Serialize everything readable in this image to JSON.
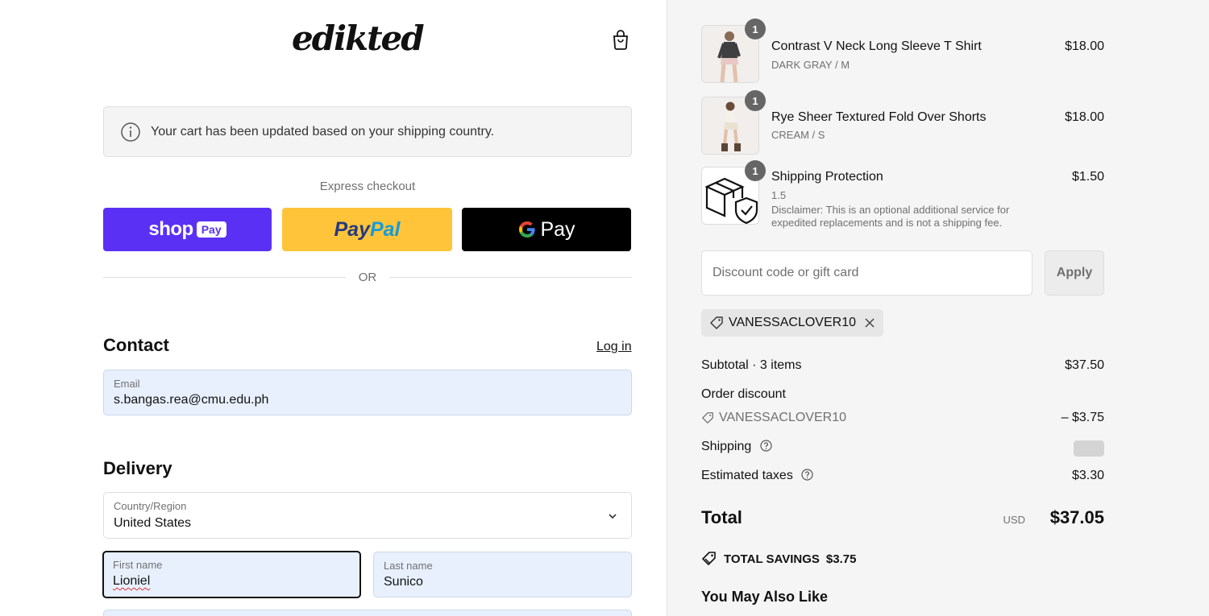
{
  "brand": {
    "logo_text": "edikted"
  },
  "header": {
    "cart_icon": "shopping-bag-icon"
  },
  "notice": {
    "text": "Your cart has been updated based on your shipping country.",
    "icon": "info-icon"
  },
  "express": {
    "label": "Express checkout",
    "shop_pay": {
      "word": "shop",
      "badge": "Pay"
    },
    "paypal": {
      "part1": "Pay",
      "part2": "Pal"
    },
    "gpay": {
      "word": "Pay"
    },
    "or_text": "OR"
  },
  "contact": {
    "title": "Contact",
    "login_label": "Log in",
    "email": {
      "label": "Email",
      "value": "s.bangas.rea@cmu.edu.ph"
    }
  },
  "delivery": {
    "title": "Delivery",
    "country": {
      "label": "Country/Region",
      "value": "United States"
    },
    "first_name": {
      "label": "First name",
      "value": "Lioniel"
    },
    "last_name": {
      "label": "Last name",
      "value": "Sunico"
    }
  },
  "order": {
    "items": [
      {
        "name": "Contrast V Neck Long Sleeve T Shirt",
        "variant": "DARK GRAY / M",
        "price": "$18.00",
        "qty": "1"
      },
      {
        "name": "Rye Sheer Textured Fold Over Shorts",
        "variant": "CREAM / S",
        "price": "$18.00",
        "qty": "1"
      },
      {
        "name": "Shipping Protection",
        "variant": "1.5",
        "price": "$1.50",
        "qty": "1",
        "note": "Disclaimer: This is an optional additional service for expedited replacements and is not a shipping fee."
      }
    ],
    "discount": {
      "placeholder": "Discount code or gift card",
      "apply_label": "Apply"
    },
    "applied_code": "VANESSACLOVER10"
  },
  "summary": {
    "subtotal_label": "Subtotal · 3 items",
    "subtotal_value": "$37.50",
    "discount_label": "Order discount",
    "discount_code": "VANESSACLOVER10",
    "discount_value": "– $3.75",
    "shipping_label": "Shipping",
    "taxes_label": "Estimated taxes",
    "taxes_value": "$3.30",
    "total_label": "Total",
    "total_currency": "USD",
    "total_value": "$37.05",
    "savings_label": "TOTAL SAVINGS",
    "savings_value": "$3.75"
  },
  "upsell": {
    "title": "You May Also Like"
  }
}
